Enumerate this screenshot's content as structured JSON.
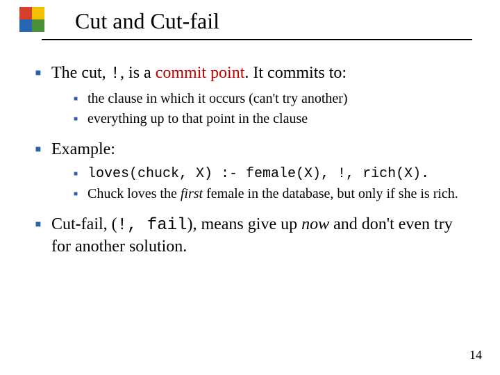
{
  "title": "Cut and Cut-fail",
  "bullets": {
    "b1": {
      "pre": "The cut, ",
      "mono": "!",
      "mid": ", is a ",
      "red": "commit point",
      "post": ". It commits to:"
    },
    "b1subs": {
      "s1": "the clause in which it occurs (can't try another)",
      "s2": "everything up to that point in the clause"
    },
    "b2": "Example:",
    "b2subs": {
      "code": " loves(chuck, X) :- female(X), !, rich(X).",
      "desc_pre": "Chuck loves the ",
      "desc_em": "first",
      "desc_post": " female in the database, but only if she is rich."
    },
    "b3": {
      "pre": "Cut-fail, (",
      "mono": "!, fail",
      "mid": "), means give up ",
      "em": "now",
      "post": " and don't even try for another solution."
    }
  },
  "page_number": "14"
}
